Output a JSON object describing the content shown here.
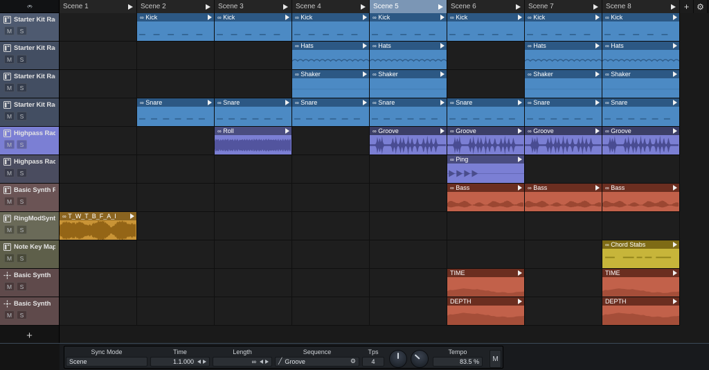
{
  "corner": {
    "icon": "resize-handle-icon",
    "label": "‹•›"
  },
  "scenes": {
    "items": [
      {
        "label": "Scene 1",
        "selected": false
      },
      {
        "label": "Scene 2",
        "selected": false
      },
      {
        "label": "Scene 3",
        "selected": false
      },
      {
        "label": "Scene 4",
        "selected": false
      },
      {
        "label": "Scene 5",
        "selected": true
      },
      {
        "label": "Scene 6",
        "selected": false
      },
      {
        "label": "Scene 7",
        "selected": false
      },
      {
        "label": "Scene 8",
        "selected": false
      }
    ],
    "add_label": "+",
    "settings_label": "⚙",
    "selected_color": "#7b96b5"
  },
  "tracks": {
    "add_label": "+",
    "mute_label": "M",
    "solo_label": "S",
    "items": [
      {
        "name": "Starter Kit Rack",
        "icon": "rack-device-icon",
        "color": "#4e5a70",
        "selected": false
      },
      {
        "name": "Starter Kit Rack",
        "icon": "rack-device-icon",
        "color": "#434e62",
        "selected": false
      },
      {
        "name": "Starter Kit Rack",
        "icon": "rack-device-icon",
        "color": "#434e62",
        "selected": false
      },
      {
        "name": "Starter Kit Rack",
        "icon": "rack-device-icon",
        "color": "#434e62",
        "selected": false
      },
      {
        "name": "Highpass Rack",
        "icon": "rack-device-icon",
        "color": "#7b7fd4",
        "selected": true
      },
      {
        "name": "Highpass Rack",
        "icon": "rack-device-icon",
        "color": "#4a4c5f",
        "selected": false
      },
      {
        "name": "Basic Synth Rack",
        "icon": "rack-device-icon",
        "color": "#6b5455",
        "selected": false
      },
      {
        "name": "RingModSynth Rac",
        "icon": "rack-device-icon",
        "color": "#6a6a58",
        "selected": false
      },
      {
        "name": "Note Key Mapper R",
        "icon": "rack-device-icon",
        "color": "#5e5f4a",
        "selected": false
      },
      {
        "name": "Basic Synth",
        "icon": "synth-device-icon",
        "color": "#5f4a4b",
        "selected": false
      },
      {
        "name": "Basic Synth",
        "icon": "synth-device-icon",
        "color": "#5f4a4b",
        "selected": false
      }
    ]
  },
  "clips": [
    {
      "track": 0,
      "scene": 1,
      "name": "Kick",
      "loop": "∞",
      "hdr": "#2c5884",
      "body": "#4c8ac4",
      "wave": "dashes-low"
    },
    {
      "track": 0,
      "scene": 2,
      "name": "Kick",
      "loop": "∞",
      "hdr": "#2c5884",
      "body": "#4c8ac4",
      "wave": "dashes-low"
    },
    {
      "track": 0,
      "scene": 3,
      "name": "Kick",
      "loop": "∞",
      "hdr": "#2c5884",
      "body": "#4c8ac4",
      "wave": "dashes-low"
    },
    {
      "track": 0,
      "scene": 4,
      "name": "Kick",
      "loop": "∞",
      "hdr": "#2c5884",
      "body": "#4c8ac4",
      "wave": "dashes-low"
    },
    {
      "track": 0,
      "scene": 5,
      "name": "Kick",
      "loop": "∞",
      "hdr": "#2c5884",
      "body": "#4c8ac4",
      "wave": "dashes-low"
    },
    {
      "track": 0,
      "scene": 6,
      "name": "Kick",
      "loop": "∞",
      "hdr": "#2c5884",
      "body": "#4c8ac4",
      "wave": "dashes-low"
    },
    {
      "track": 0,
      "scene": 7,
      "name": "Kick",
      "loop": "∞",
      "hdr": "#2c5884",
      "body": "#4c8ac4",
      "wave": "dashes-low"
    },
    {
      "track": 1,
      "scene": 3,
      "name": "Hats",
      "loop": "∞",
      "hdr": "#2c5884",
      "body": "#4c8ac4",
      "wave": "hats"
    },
    {
      "track": 1,
      "scene": 4,
      "name": "Hats",
      "loop": "∞",
      "hdr": "#2c5884",
      "body": "#4c8ac4",
      "wave": "hats"
    },
    {
      "track": 1,
      "scene": 6,
      "name": "Hats",
      "loop": "∞",
      "hdr": "#2c5884",
      "body": "#4c8ac4",
      "wave": "hats"
    },
    {
      "track": 1,
      "scene": 7,
      "name": "Hats",
      "loop": "∞",
      "hdr": "#2c5884",
      "body": "#4c8ac4",
      "wave": "hats"
    },
    {
      "track": 2,
      "scene": 3,
      "name": "Shaker",
      "loop": "∞",
      "hdr": "#2c5884",
      "body": "#4c8ac4",
      "wave": "flat"
    },
    {
      "track": 2,
      "scene": 4,
      "name": "Shaker",
      "loop": "∞",
      "hdr": "#2c5884",
      "body": "#4c8ac4",
      "wave": "flat"
    },
    {
      "track": 2,
      "scene": 6,
      "name": "Shaker",
      "loop": "∞",
      "hdr": "#2c5884",
      "body": "#4c8ac4",
      "wave": "flat"
    },
    {
      "track": 2,
      "scene": 7,
      "name": "Shaker",
      "loop": "∞",
      "hdr": "#2c5884",
      "body": "#4c8ac4",
      "wave": "flat"
    },
    {
      "track": 3,
      "scene": 1,
      "name": "Snare",
      "loop": "∞",
      "hdr": "#2c5884",
      "body": "#4c8ac4",
      "wave": "dashes-mid"
    },
    {
      "track": 3,
      "scene": 2,
      "name": "Snare",
      "loop": "∞",
      "hdr": "#2c5884",
      "body": "#4c8ac4",
      "wave": "dashes-mid"
    },
    {
      "track": 3,
      "scene": 3,
      "name": "Snare",
      "loop": "∞",
      "hdr": "#2c5884",
      "body": "#4c8ac4",
      "wave": "dashes-mid"
    },
    {
      "track": 3,
      "scene": 4,
      "name": "Snare",
      "loop": "∞",
      "hdr": "#2c5884",
      "body": "#4c8ac4",
      "wave": "dashes-mid"
    },
    {
      "track": 3,
      "scene": 5,
      "name": "Snare",
      "loop": "∞",
      "hdr": "#2c5884",
      "body": "#4c8ac4",
      "wave": "dashes-mid"
    },
    {
      "track": 3,
      "scene": 6,
      "name": "Snare",
      "loop": "∞",
      "hdr": "#2c5884",
      "body": "#4c8ac4",
      "wave": "dashes-mid"
    },
    {
      "track": 3,
      "scene": 7,
      "name": "Snare",
      "loop": "∞",
      "hdr": "#2c5884",
      "body": "#4c8ac4",
      "wave": "dashes-mid"
    },
    {
      "track": 4,
      "scene": 2,
      "name": "Roll",
      "loop": "∞",
      "hdr": "#4a4d80",
      "body": "#7b7fd4",
      "wave": "roll"
    },
    {
      "track": 4,
      "scene": 4,
      "name": "Groove",
      "loop": "∞",
      "hdr": "#3b3e66",
      "body": "#7b7fd4",
      "wave": "groove"
    },
    {
      "track": 4,
      "scene": 5,
      "name": "Groove",
      "loop": "∞",
      "hdr": "#3b3e66",
      "body": "#7b7fd4",
      "wave": "groove"
    },
    {
      "track": 4,
      "scene": 6,
      "name": "Groove",
      "loop": "∞",
      "hdr": "#3b3e66",
      "body": "#7b7fd4",
      "wave": "groove"
    },
    {
      "track": 4,
      "scene": 7,
      "name": "Groove",
      "loop": "∞",
      "hdr": "#3b3e66",
      "body": "#7b7fd4",
      "wave": "groove"
    },
    {
      "track": 5,
      "scene": 5,
      "name": "Ping",
      "loop": "∞",
      "hdr": "#4a4d80",
      "body": "#7b7fd4",
      "wave": "ping"
    },
    {
      "track": 6,
      "scene": 5,
      "name": "Bass",
      "loop": "∞",
      "hdr": "#6b2e20",
      "body": "#c2614a",
      "wave": "bass"
    },
    {
      "track": 6,
      "scene": 6,
      "name": "Bass",
      "loop": "∞",
      "hdr": "#6b2e20",
      "body": "#c2614a",
      "wave": "bass"
    },
    {
      "track": 6,
      "scene": 7,
      "name": "Bass",
      "loop": "∞",
      "hdr": "#6b2e20",
      "body": "#c2614a",
      "wave": "bass"
    },
    {
      "track": 7,
      "scene": 0,
      "name": "T_W_T_B_F_A_I",
      "loop": "∞",
      "hdr": "#8a6420",
      "body": "#c99436",
      "wave": "audio"
    },
    {
      "track": 8,
      "scene": 7,
      "name": "Chord Stabs",
      "loop": "∞",
      "hdr": "#7e6b15",
      "body": "#c7b53a",
      "wave": "stabs"
    },
    {
      "track": 9,
      "scene": 5,
      "name": "TIME",
      "loop": "",
      "hdr": "#6b2e20",
      "body": "#c2614a",
      "wave": "auto-time"
    },
    {
      "track": 9,
      "scene": 7,
      "name": "TIME",
      "loop": "",
      "hdr": "#6b2e20",
      "body": "#c2614a",
      "wave": "auto-time"
    },
    {
      "track": 10,
      "scene": 5,
      "name": "DEPTH",
      "loop": "",
      "hdr": "#6b2e20",
      "body": "#c2614a",
      "wave": "auto-depth"
    },
    {
      "track": 10,
      "scene": 7,
      "name": "DEPTH",
      "loop": "",
      "hdr": "#6b2e20",
      "body": "#c2614a",
      "wave": "auto-depth"
    }
  ],
  "transport": {
    "sync_mode": {
      "label": "Sync Mode",
      "value": "Scene"
    },
    "time": {
      "label": "Time",
      "value": "1.1.000"
    },
    "length": {
      "label": "Length",
      "value": "∞"
    },
    "sequence": {
      "label": "Sequence",
      "value": "Groove",
      "gear": "⚙",
      "edit_icon": "pencil-icon"
    },
    "tps": {
      "label": "Tps",
      "value": "4"
    },
    "tempo": {
      "label": "Tempo",
      "value": "83.5 %"
    },
    "knob_a": {
      "name": "swing-knob",
      "angle": 0
    },
    "knob_b": {
      "name": "amount-knob",
      "angle": -48
    },
    "metronome": {
      "label": "M"
    }
  }
}
